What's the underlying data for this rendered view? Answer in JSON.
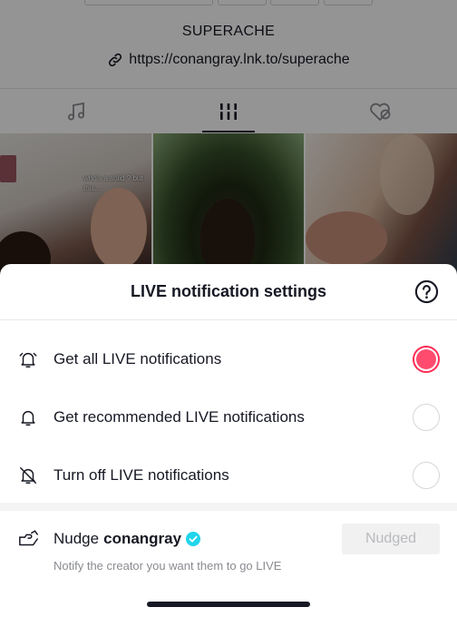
{
  "profile": {
    "bio": "SUPERACHE",
    "link": "https://conangray.lnk.to/superache",
    "tabs": [
      {
        "icon": "music-note-icon"
      },
      {
        "icon": "grid-bars-icon",
        "active": true
      },
      {
        "icon": "liked-hearts-icon"
      }
    ],
    "thumb_caption": "who's a solid ? but this..."
  },
  "sheet": {
    "title": "LIVE notification settings",
    "help_icon": "question-circle-icon",
    "options": [
      {
        "label": "Get all LIVE notifications",
        "icon": "bell-ringing-icon",
        "selected": true
      },
      {
        "label": "Get recommended LIVE notifications",
        "icon": "bell-icon",
        "selected": false
      },
      {
        "label": "Turn off LIVE notifications",
        "icon": "bell-off-icon",
        "selected": false
      }
    ],
    "nudge": {
      "prefix": "Nudge",
      "username": "conangray",
      "subtitle": "Notify the creator you want them to go LIVE",
      "button_label": "Nudged",
      "verified_icon": "verified-badge-icon"
    }
  },
  "colors": {
    "accent": "#fe2c55",
    "verified": "#20d5ec",
    "text": "#161823",
    "muted": "#8a8b91"
  }
}
